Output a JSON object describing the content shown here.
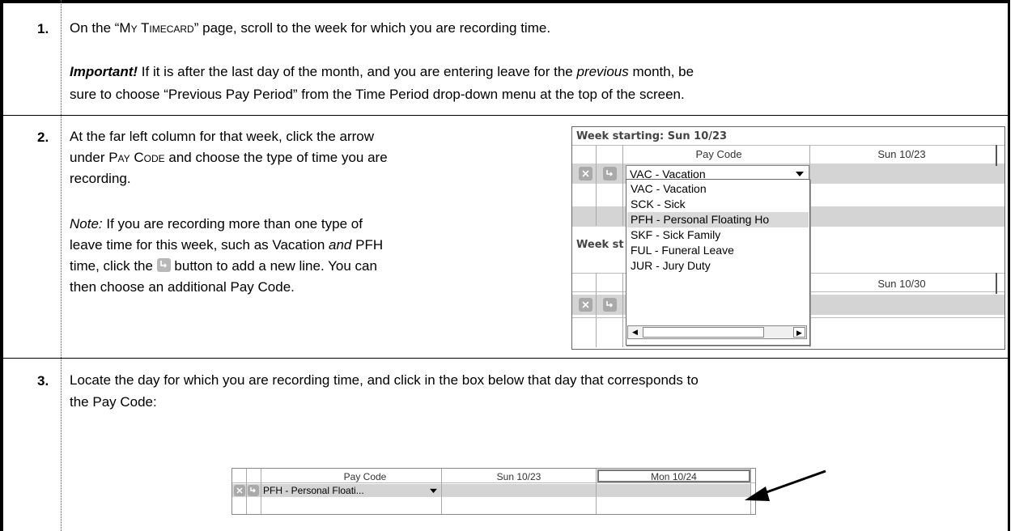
{
  "steps": [
    {
      "number": "1.",
      "line1_pre": "On the “",
      "line1_sc": "My Timecard",
      "line1_post": "” page, scroll to the week for which you are recording time.",
      "important_label": "Important!",
      "important_pre": " If it is after the last day of the month, and you are entering leave for the ",
      "important_italic": "previous",
      "important_post": " month, be",
      "important_line2": "sure to choose “Previous Pay Period” from the Time Period drop-down menu at the top of the screen."
    },
    {
      "number": "2.",
      "line1": "At the far left column for that week, click the arrow",
      "line2_pre": "under ",
      "line2_sc": "Pay Code",
      "line2_post": " and choose the type of time you are",
      "line3": "recording.",
      "note_label": "Note:",
      "note_line1_post": " If you are recording more than one type of",
      "note_line2_pre": "leave time for this week, such as Vacation ",
      "note_line2_italic": "and",
      "note_line2_post": " PFH",
      "note_line3_pre": "time, click the ",
      "note_line3_post": " button to add a new line.  You can",
      "note_line4": "then choose an additional Pay Code."
    },
    {
      "number": "3.",
      "line1": "Locate the day for which you are recording time, and click in the box below that day that corresponds to",
      "line2": "the Pay Code:"
    }
  ],
  "screenshot1": {
    "week1_heading": "Week starting: Sun 10/23",
    "week2_heading_visible": "Week st",
    "col_paycode": "Pay Code",
    "col_day1": "Sun 10/23",
    "col_day2": "Sun 10/30",
    "selected_value": "VAC - Vacation",
    "dropdown_options": [
      "VAC - Vacation",
      "SCK - Sick",
      "PFH - Personal Floating Ho",
      "SKF - Sick Family",
      "FUL - Funeral Leave",
      "JUR - Jury Duty"
    ],
    "highlighted_index": 2
  },
  "screenshot2": {
    "col_paycode": "Pay Code",
    "col_day1": "Sun 10/23",
    "col_day2": "Mon 10/24",
    "selected_value": "PFH - Personal Floati..."
  },
  "colors": {
    "grey_row": "#d4d4d4",
    "icon_grey": "#a9a9a9",
    "border": "#000000"
  }
}
